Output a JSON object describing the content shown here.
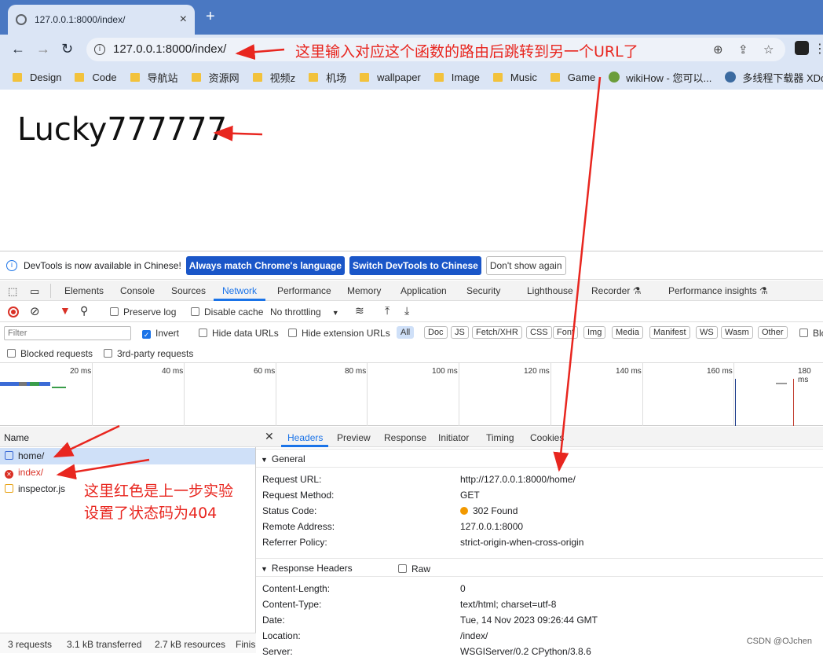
{
  "tab": {
    "title": "127.0.0.1:8000/index/",
    "close": "×",
    "new": "+"
  },
  "toolbar": {
    "back": "←",
    "forward": "→",
    "reload": "↻",
    "url": "127.0.0.1:8000/index/",
    "info": "i",
    "zoom": "⊕",
    "share": "⇪",
    "star": "☆",
    "menu": "⋮"
  },
  "bookmarks": [
    "Design",
    "Code",
    "导航站",
    "资源网",
    "视频z",
    "机场",
    "wallpaper",
    "Image",
    "Music",
    "Game"
  ],
  "bookmarks_site": [
    {
      "label": "wikiHow - 您可以..."
    },
    {
      "label": "多线程下载器 XDo..."
    }
  ],
  "page": {
    "heading": "Lucky777777"
  },
  "infobar": {
    "text": "DevTools is now available in Chinese!",
    "btn1": "Always match Chrome's language",
    "btn2": "Switch DevTools to Chinese",
    "btn3": "Don't show again"
  },
  "devtools_tabs": [
    "Elements",
    "Console",
    "Sources",
    "Network",
    "Performance",
    "Memory",
    "Application",
    "Security",
    "Lighthouse",
    "Recorder ⚗",
    "Performance insights ⚗"
  ],
  "network_bar": {
    "preserve_log": "Preserve log",
    "disable_cache": "Disable cache",
    "throttling": "No throttling"
  },
  "filter": {
    "placeholder": "Filter",
    "invert": "Invert",
    "hide_data": "Hide data URLs",
    "hide_ext": "Hide extension URLs",
    "chips": [
      "All",
      "Doc",
      "JS",
      "Fetch/XHR",
      "CSS",
      "Font",
      "Img",
      "Media",
      "Manifest",
      "WS",
      "Wasm",
      "Other"
    ],
    "blocked_cookies": "Blo"
  },
  "filter2": {
    "blocked_requests": "Blocked requests",
    "third_party": "3rd-party requests"
  },
  "timeline_ticks": [
    "20 ms",
    "40 ms",
    "60 ms",
    "80 ms",
    "100 ms",
    "120 ms",
    "140 ms",
    "160 ms",
    "180 ms"
  ],
  "requests": {
    "header": "Name",
    "rows": [
      {
        "name": "home/",
        "type": "doc",
        "color": "#3b6bd6"
      },
      {
        "name": "index/",
        "type": "error",
        "color": "#d93025"
      },
      {
        "name": "inspector.js",
        "type": "script",
        "color": "#e8a317"
      }
    ]
  },
  "details": {
    "close": "✕",
    "tabs": [
      "Headers",
      "Preview",
      "Response",
      "Initiator",
      "Timing",
      "Cookies"
    ],
    "general_title": "General",
    "general": [
      {
        "k": "Request URL:",
        "v": "http://127.0.0.1:8000/home/"
      },
      {
        "k": "Request Method:",
        "v": "GET"
      },
      {
        "k": "Status Code:",
        "v": "302 Found"
      },
      {
        "k": "Remote Address:",
        "v": "127.0.0.1:8000"
      },
      {
        "k": "Referrer Policy:",
        "v": "strict-origin-when-cross-origin"
      }
    ],
    "response_title": "Response Headers",
    "raw": "Raw",
    "response": [
      {
        "k": "Content-Length:",
        "v": "0"
      },
      {
        "k": "Content-Type:",
        "v": "text/html; charset=utf-8"
      },
      {
        "k": "Date:",
        "v": "Tue, 14 Nov 2023 09:26:44 GMT"
      },
      {
        "k": "Location:",
        "v": "/index/"
      },
      {
        "k": "Server:",
        "v": "WSGIServer/0.2 CPython/3.8.6"
      }
    ]
  },
  "statusbar": {
    "requests": "3 requests",
    "transferred": "3.1 kB transferred",
    "resources": "2.7 kB resources",
    "finish": "Finis"
  },
  "annotations": {
    "top": "这里输入对应这个函数的路由后跳转到另一个URL了",
    "red1": "这里红色是上一步实验",
    "red2": "设置了状态码为404"
  },
  "watermark": "CSDN @OJchen",
  "colors": {
    "accent": "#1a73e8",
    "annotation": "#e8261f",
    "status_dot": "#f29900"
  }
}
